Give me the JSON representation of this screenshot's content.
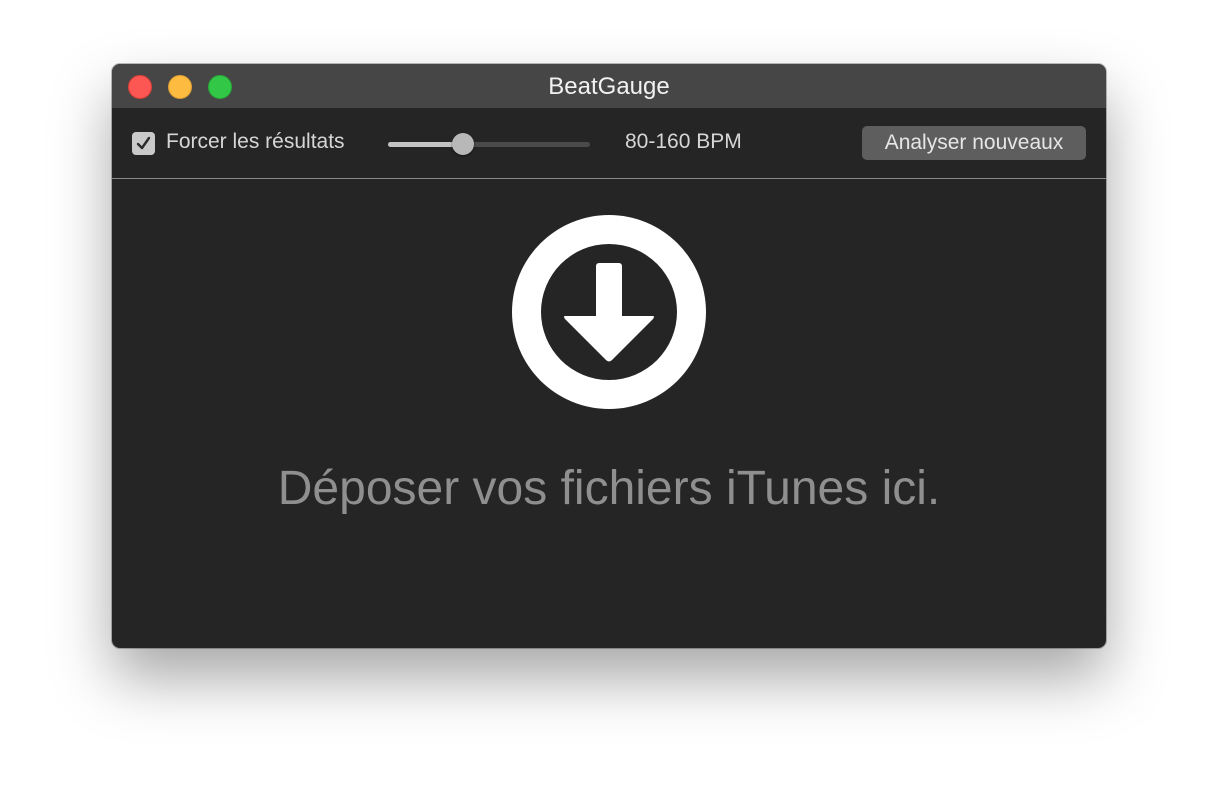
{
  "window": {
    "title": "BeatGauge"
  },
  "toolbar": {
    "checkbox_label": "Forcer les résultats",
    "checkbox_checked": true,
    "slider_value_fraction": 0.37,
    "bpm_range": "80-160 BPM",
    "analyze_button": "Analyser nouveaux"
  },
  "drop_zone": {
    "icon": "download-arrow-circle-icon",
    "message": "Déposer vos fichiers iTunes ici."
  },
  "colors": {
    "close": "#fc5753",
    "minimize": "#fdbc40",
    "maximize": "#33c748",
    "background": "#252525"
  }
}
